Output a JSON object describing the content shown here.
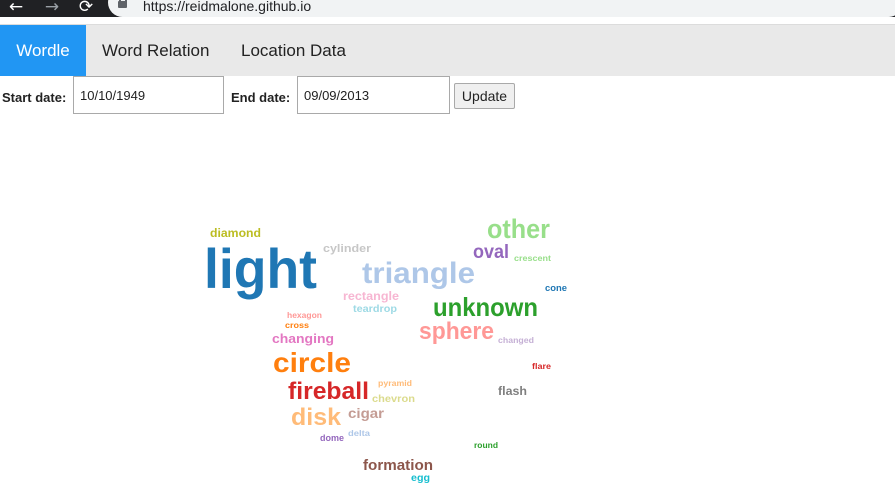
{
  "browser": {
    "url": "https://reidmalone.github.io",
    "back_icon": "←",
    "forward_icon": "→",
    "reload_icon": "⟳"
  },
  "nav": {
    "tabs": [
      {
        "label": "Wordle",
        "active": true
      },
      {
        "label": "Word Relation",
        "active": false
      },
      {
        "label": "Location Data",
        "active": false
      }
    ],
    "active_color": "#2196f3"
  },
  "form": {
    "start_label": "Start date:",
    "start_value": "10/10/1949",
    "end_label": "End date:",
    "end_value": "09/09/2013",
    "update_label": "Update"
  },
  "wordcloud": {
    "words": [
      {
        "text": "diamond",
        "color": "#bcbd22"
      },
      {
        "text": "light",
        "color": "#1f77b4"
      },
      {
        "text": "cylinder",
        "color": "#c7c7c7"
      },
      {
        "text": "triangle",
        "color": "#aec7e8"
      },
      {
        "text": "other",
        "color": "#98df8a"
      },
      {
        "text": "oval",
        "color": "#9467bd"
      },
      {
        "text": "crescent",
        "color": "#98df8a"
      },
      {
        "text": "cone",
        "color": "#1f77b4"
      },
      {
        "text": "rectangle",
        "color": "#f7b6d2"
      },
      {
        "text": "teardrop",
        "color": "#9edae5"
      },
      {
        "text": "unknown",
        "color": "#2ca02c"
      },
      {
        "text": "hexagon",
        "color": "#ff9896"
      },
      {
        "text": "cross",
        "color": "#ff7f0e"
      },
      {
        "text": "changing",
        "color": "#e377c2"
      },
      {
        "text": "sphere",
        "color": "#ff9896"
      },
      {
        "text": "changed",
        "color": "#c5b0d5"
      },
      {
        "text": "circle",
        "color": "#ff7f0e"
      },
      {
        "text": "flare",
        "color": "#d62728"
      },
      {
        "text": "pyramid",
        "color": "#ffbb78"
      },
      {
        "text": "fireball",
        "color": "#d62728"
      },
      {
        "text": "chevron",
        "color": "#dbdb8d"
      },
      {
        "text": "flash",
        "color": "#7f7f7f"
      },
      {
        "text": "cigar",
        "color": "#c49c94"
      },
      {
        "text": "disk",
        "color": "#ffbb78"
      },
      {
        "text": "delta",
        "color": "#aec7e8"
      },
      {
        "text": "dome",
        "color": "#9467bd"
      },
      {
        "text": "round",
        "color": "#2ca02c"
      },
      {
        "text": "formation",
        "color": "#8c564b"
      },
      {
        "text": "egg",
        "color": "#17becf"
      }
    ]
  }
}
